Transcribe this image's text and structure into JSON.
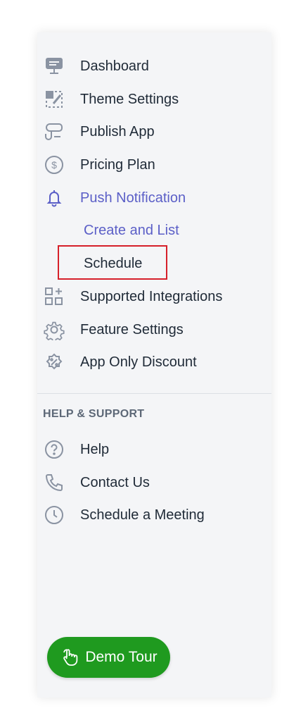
{
  "menu": {
    "items": [
      {
        "label": "Dashboard",
        "icon": "dashboard-icon"
      },
      {
        "label": "Theme Settings",
        "icon": "theme-icon"
      },
      {
        "label": "Publish App",
        "icon": "publish-icon"
      },
      {
        "label": "Pricing Plan",
        "icon": "pricing-icon"
      },
      {
        "label": "Push Notification",
        "icon": "bell-icon"
      },
      {
        "label": "Supported Integrations",
        "icon": "integrations-icon"
      },
      {
        "label": "Feature Settings",
        "icon": "gear-icon"
      },
      {
        "label": "App Only Discount",
        "icon": "discount-icon"
      }
    ],
    "push_submenu": [
      {
        "label": "Create and List"
      },
      {
        "label": "Schedule"
      }
    ]
  },
  "help": {
    "section_title": "HELP & SUPPORT",
    "items": [
      {
        "label": "Help",
        "icon": "help-icon"
      },
      {
        "label": "Contact Us",
        "icon": "phone-icon"
      },
      {
        "label": "Schedule a Meeting",
        "icon": "clock-icon"
      }
    ]
  },
  "demo_button": {
    "label": "Demo Tour",
    "icon": "hand-pointer-icon"
  },
  "colors": {
    "active": "#5b5fc7",
    "text": "#1f2a37",
    "icon": "#8a93a2",
    "highlight": "#d6202a",
    "demo_button": "#1f9a1f"
  }
}
